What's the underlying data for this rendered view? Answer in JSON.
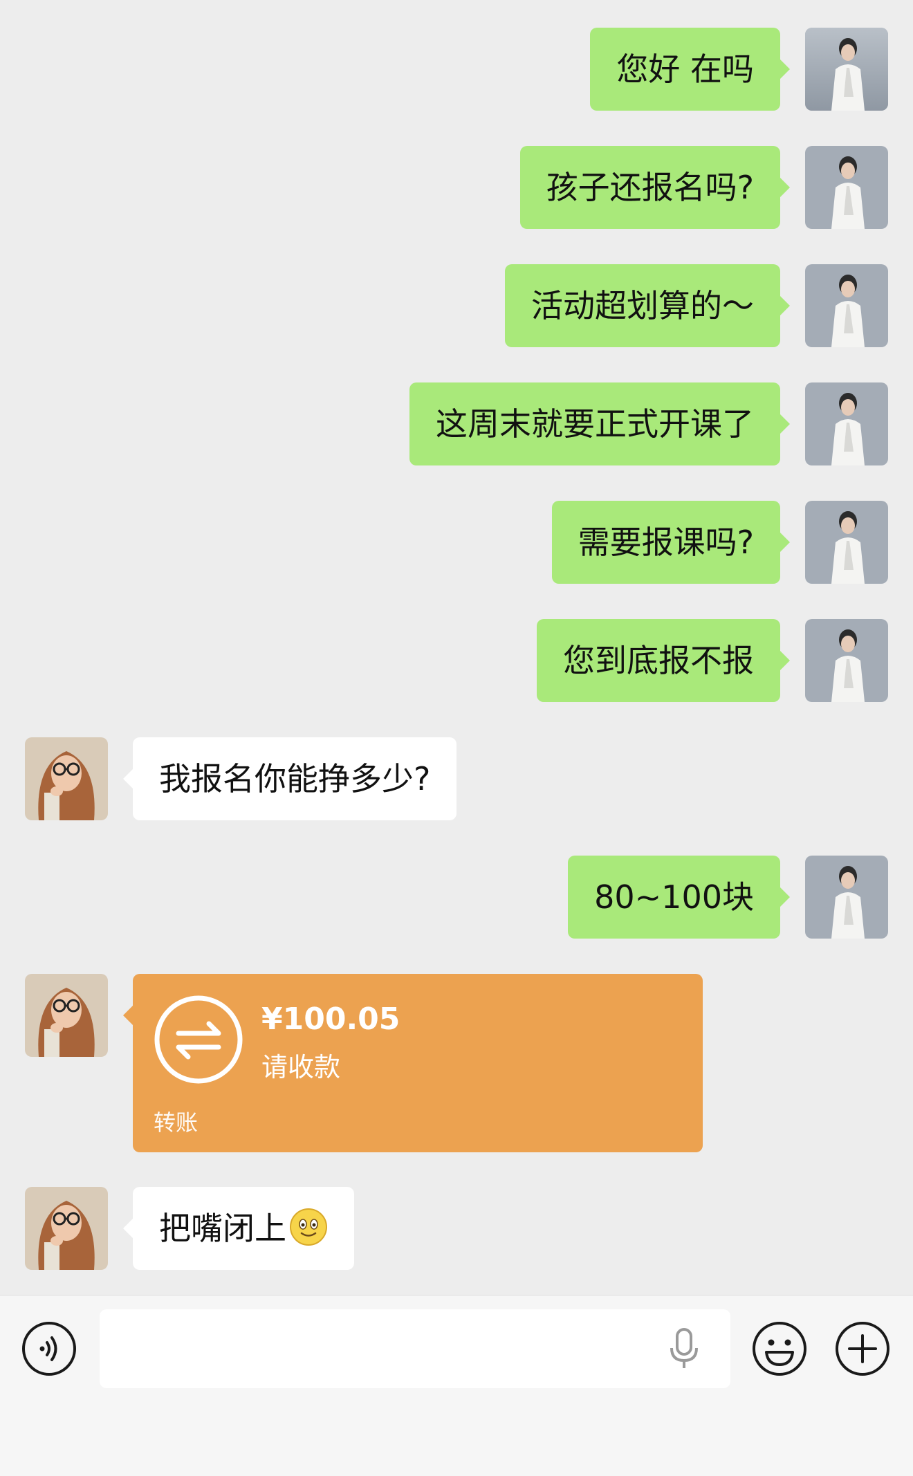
{
  "messages": [
    {
      "side": "out",
      "text": "您好 在吗"
    },
    {
      "side": "out",
      "text": "孩子还报名吗?"
    },
    {
      "side": "out",
      "text": "活动超划算的～"
    },
    {
      "side": "out",
      "text": "这周末就要正式开课了"
    },
    {
      "side": "out",
      "text": "需要报课吗?"
    },
    {
      "side": "out",
      "text": "您到底报不报"
    },
    {
      "side": "in",
      "text": "我报名你能挣多少?"
    },
    {
      "side": "out",
      "text": "80~100块"
    },
    {
      "side": "in",
      "type": "transfer",
      "amount": "¥100.05",
      "note": "请收款",
      "label": "转账"
    },
    {
      "side": "in",
      "text": "把嘴闭上",
      "emoji": "smile-emoji"
    }
  ],
  "input_bar": {
    "placeholder": "",
    "voice_icon": "voice-icon",
    "mic_icon": "microphone-icon",
    "emoji_icon": "emoji-icon",
    "plus_icon": "plus-icon"
  },
  "colors": {
    "outgoing_bubble": "#a9e97a",
    "incoming_bubble": "#ffffff",
    "transfer_card": "#eca250",
    "chat_background": "#ededed"
  }
}
